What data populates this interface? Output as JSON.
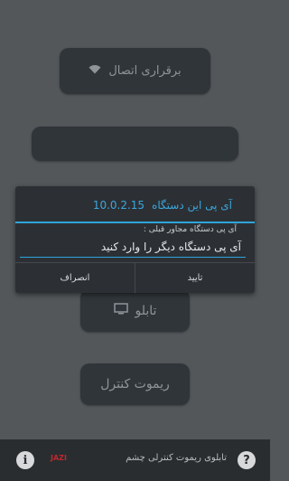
{
  "main": {
    "connect_label": "برقراری اتصال",
    "connect_icon": "wifi-icon",
    "status_text": "",
    "tablo_label": "تابلو",
    "tablo_icon": "monitor-icon",
    "remote_label": "ریموت کنترل"
  },
  "dialog": {
    "title": "آی پی این دستگاه",
    "ip_address": "10.0.2.15",
    "input_label": "آی پی دستگاه مجاور قبلی :",
    "input_value": "آی پی دستگاه دیگر را وارد کنید",
    "confirm_label": "تایید",
    "cancel_label": "انصراف"
  },
  "footer": {
    "info_glyph": "i",
    "brand": "JAZI",
    "app_name": "تابلوی ریموت کنترلی چشم",
    "help_glyph": "?"
  },
  "colors": {
    "background": "#53575a",
    "button": "#30353a",
    "accent": "#2ea3db",
    "brand": "#c0272d"
  }
}
